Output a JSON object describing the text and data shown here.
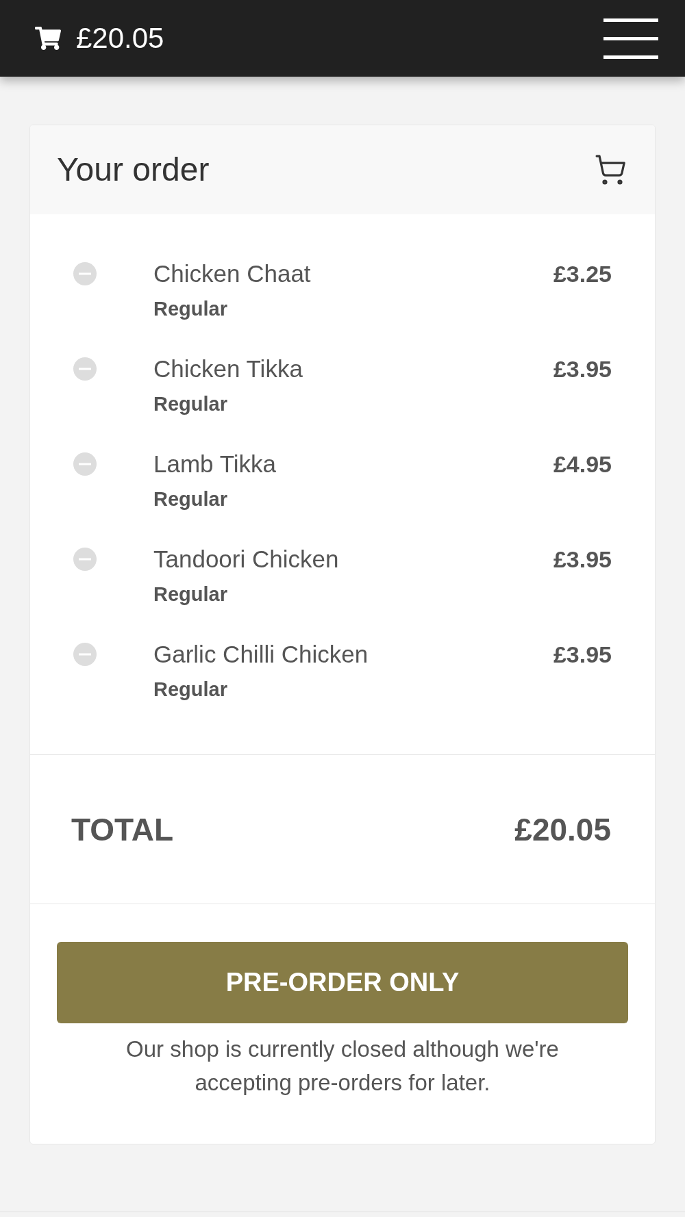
{
  "header": {
    "cart_total": "£20.05"
  },
  "order": {
    "title": "Your order",
    "items": [
      {
        "name": "Chicken Chaat",
        "option": "Regular",
        "price": "£3.25"
      },
      {
        "name": "Chicken Tikka",
        "option": "Regular",
        "price": "£3.95"
      },
      {
        "name": "Lamb Tikka",
        "option": "Regular",
        "price": "£4.95"
      },
      {
        "name": "Tandoori Chicken",
        "option": "Regular",
        "price": "£3.95"
      },
      {
        "name": "Garlic Chilli Chicken",
        "option": "Regular",
        "price": "£3.95"
      }
    ],
    "total": {
      "label": "TOTAL",
      "amount": "£20.05"
    },
    "action": {
      "label": "PRE-ORDER ONLY",
      "note": "Our shop is currently closed although we're accepting pre-orders for later."
    }
  }
}
